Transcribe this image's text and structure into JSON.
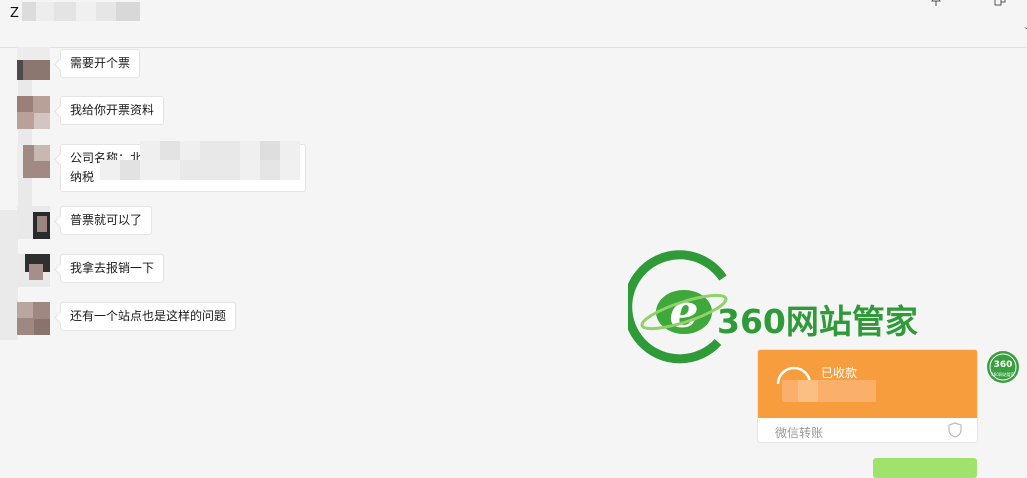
{
  "header": {
    "title": "Z"
  },
  "messages": [
    {
      "text": "需要开个票"
    },
    {
      "text": "我给你开票资料"
    },
    {
      "line1": "公司名称：北京",
      "line2": "纳税"
    },
    {
      "text": "普票就可以了"
    },
    {
      "text": "我拿去报销一下"
    },
    {
      "text": "还有一个站点也是这样的问题"
    }
  ],
  "watermark": {
    "text": "360网站管家",
    "seal_text": "360网站管家"
  },
  "transfer": {
    "status": "已收款",
    "footer": "微信转账"
  },
  "colors": {
    "background": "#f5f5f5",
    "transfer_orange": "#f89d3e",
    "brand_green": "#2f9a38",
    "own_bubble_green": "#9fe26c"
  },
  "icons": [
    "pin-icon",
    "popout-icon",
    "received-icon",
    "shield-icon",
    "e-logo-icon"
  ]
}
